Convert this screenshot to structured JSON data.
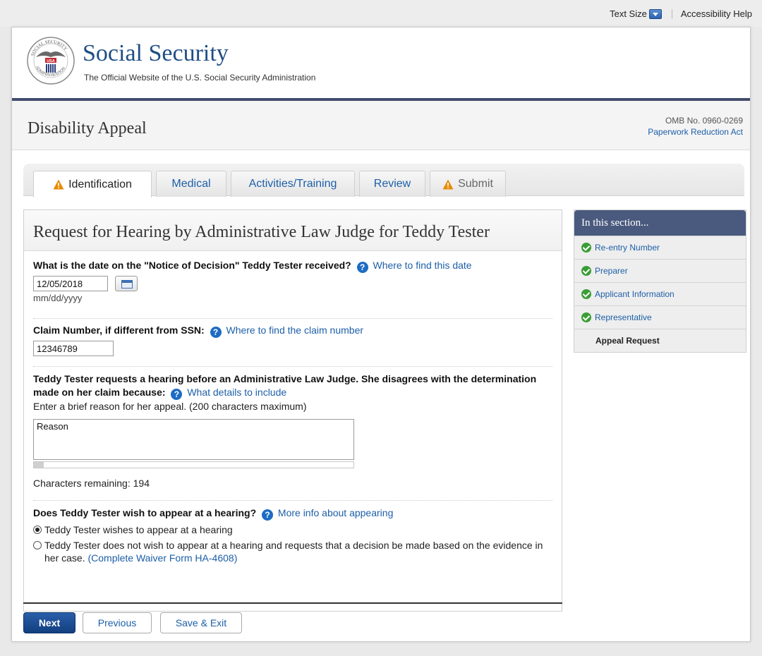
{
  "utility": {
    "text_size_label": "Text Size",
    "accessibility_help": "Accessibility Help"
  },
  "header": {
    "site_title": "Social Security",
    "site_subtitle": "The Official Website of the U.S. Social Security Administration",
    "seal_text": "SOCIAL SECURITY ADMINISTRATION USA"
  },
  "page": {
    "title": "Disability Appeal",
    "omb_number": "OMB No. 0960-0269",
    "paperwork_link": "Paperwork Reduction Act"
  },
  "tabs": [
    {
      "label": "Identification",
      "state": "active",
      "icon": "warning-icon"
    },
    {
      "label": "Medical",
      "state": "normal"
    },
    {
      "label": "Activities/Training",
      "state": "normal"
    },
    {
      "label": "Review",
      "state": "normal"
    },
    {
      "label": "Submit",
      "state": "disabled",
      "icon": "warning-icon"
    }
  ],
  "form": {
    "heading": "Request for Hearing by Administrative Law Judge for Teddy Tester",
    "notice_date": {
      "question": "What is the date on the \"Notice of Decision\" Teddy Tester received?",
      "help_link": "Where to find this date",
      "value": "12/05/2018",
      "format_hint": "mm/dd/yyyy"
    },
    "claim_number": {
      "question": "Claim Number, if different from SSN:",
      "help_link": "Where to find the claim number",
      "value": "12346789"
    },
    "reason": {
      "question": "Teddy Tester requests a hearing before an Administrative Law Judge. She disagrees with the determination made on her claim because:",
      "help_link": "What details to include",
      "instruction": "Enter a brief reason for her appeal. (200 characters maximum)",
      "value": "Reason",
      "chars_remaining_label": "Characters remaining:",
      "chars_remaining": "194",
      "used_fraction": 0.03
    },
    "appear": {
      "question": "Does Teddy Tester wish to appear at a hearing?",
      "help_link": "More info about appearing",
      "option_yes": "Teddy Tester wishes to appear at a hearing",
      "option_no": "Teddy Tester does not wish to appear at a hearing and requests that a decision be made based on the evidence in her case.",
      "waiver_link": "(Complete Waiver Form HA-4608)",
      "selected": "yes"
    }
  },
  "sidebar": {
    "heading": "In this section...",
    "items": [
      {
        "label": "Re-entry Number",
        "done": true
      },
      {
        "label": "Preparer",
        "done": true
      },
      {
        "label": "Applicant Information",
        "done": true
      },
      {
        "label": "Representative",
        "done": true
      },
      {
        "label": "Appeal Request",
        "done": false,
        "current": true
      }
    ]
  },
  "buttons": {
    "next": "Next",
    "previous": "Previous",
    "save_exit": "Save & Exit"
  },
  "colors": {
    "brand_blue": "#1f4e85",
    "link_blue": "#1d5fa8",
    "sidebar_header": "#4a5a7e",
    "check_green": "#3a9d35",
    "warning_orange": "#e88a00"
  }
}
